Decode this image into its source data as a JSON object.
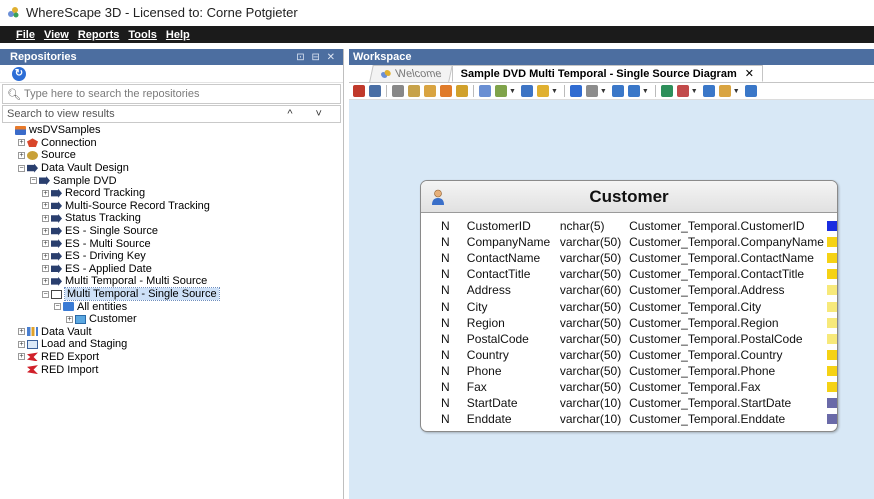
{
  "window": {
    "title": "WhereScape 3D - Licensed to: Corne Potgieter"
  },
  "menu": [
    "File",
    "View",
    "Reports",
    "Tools",
    "Help"
  ],
  "repositories": {
    "header": "Repositories",
    "header_controls": "⊡ ⊟ ✕",
    "search_placeholder": "Type here to search the repositories",
    "results_text": "Search to view results",
    "results_nav": "^ ˅"
  },
  "tree": [
    {
      "label": "wsDVSamples",
      "depth": 0,
      "icon": "database-icon",
      "iconClass": "ico-db",
      "expander": ""
    },
    {
      "label": "Connection",
      "depth": 1,
      "icon": "connection-icon",
      "iconClass": "ico-conn",
      "expander": "+"
    },
    {
      "label": "Source",
      "depth": 1,
      "icon": "source-icon",
      "iconClass": "ico-src",
      "expander": "+"
    },
    {
      "label": "Data Vault Design",
      "depth": 1,
      "icon": "model-icon",
      "iconClass": "ico-dv",
      "expander": "−"
    },
    {
      "label": "Sample DVD",
      "depth": 2,
      "icon": "model-icon",
      "iconClass": "ico-dv",
      "expander": "−"
    },
    {
      "label": "Record Tracking",
      "depth": 3,
      "icon": "model-icon",
      "iconClass": "ico-dv",
      "expander": "+"
    },
    {
      "label": "Multi-Source Record Tracking",
      "depth": 3,
      "icon": "model-icon",
      "iconClass": "ico-dv",
      "expander": "+"
    },
    {
      "label": "Status Tracking",
      "depth": 3,
      "icon": "model-icon",
      "iconClass": "ico-dv",
      "expander": "+"
    },
    {
      "label": "ES - Single Source",
      "depth": 3,
      "icon": "model-icon",
      "iconClass": "ico-dv",
      "expander": "+"
    },
    {
      "label": "ES - Multi Source",
      "depth": 3,
      "icon": "model-icon",
      "iconClass": "ico-dv",
      "expander": "+"
    },
    {
      "label": "ES - Driving Key",
      "depth": 3,
      "icon": "model-icon",
      "iconClass": "ico-dv",
      "expander": "+"
    },
    {
      "label": "ES - Applied Date",
      "depth": 3,
      "icon": "model-icon",
      "iconClass": "ico-dv",
      "expander": "+"
    },
    {
      "label": "Multi Temporal - Multi Source",
      "depth": 3,
      "icon": "model-icon",
      "iconClass": "ico-dv",
      "expander": "+"
    },
    {
      "label": "Multi Temporal - Single Source",
      "depth": 3,
      "icon": "document-icon",
      "iconClass": "ico-doc",
      "expander": "−",
      "selected": true
    },
    {
      "label": "All entities",
      "depth": 4,
      "icon": "entities-icon",
      "iconClass": "ico-entities",
      "expander": "−"
    },
    {
      "label": "Customer",
      "depth": 5,
      "icon": "entity-icon",
      "iconClass": "ico-cust",
      "expander": "+"
    },
    {
      "label": "Data Vault",
      "depth": 1,
      "icon": "data-vault-icon",
      "iconClass": "ico-vault",
      "expander": "+"
    },
    {
      "label": "Load and Staging",
      "depth": 1,
      "icon": "load-icon",
      "iconClass": "ico-load",
      "expander": "+"
    },
    {
      "label": "RED Export",
      "depth": 1,
      "icon": "red-export-icon",
      "iconClass": "ico-red",
      "expander": "+"
    },
    {
      "label": "RED Import",
      "depth": 1,
      "icon": "red-import-icon",
      "iconClass": "ico-red",
      "expander": ""
    }
  ],
  "workspace": {
    "header": "Workspace",
    "tabs": [
      {
        "label": "Welcome",
        "active": false
      },
      {
        "label": "Sample DVD Multi Temporal - Single Source Diagram",
        "active": true,
        "close": "✕"
      }
    ]
  },
  "toolbar_colors": [
    "#c0392b",
    "#4a6fa5",
    "#888888",
    "#c7a24a",
    "#d9a441",
    "#e07b2a",
    "#d1a12b",
    "#6a8fd3",
    "#7fa34a",
    "#3d74c4",
    "#e0b030",
    "#2f6bd1",
    "#8c8c8c",
    "#3a77c8",
    "#3a77c8",
    "#2d8f5a",
    "#c24a4a",
    "#3a77c8",
    "#d9a441",
    "#3a77c8"
  ],
  "entity": {
    "title": "Customer",
    "attributes": [
      {
        "flag": "N",
        "name": "CustomerID",
        "type": "nchar(5)",
        "source": "Customer_Temporal.CustomerID",
        "color": "#1a2de0"
      },
      {
        "flag": "N",
        "name": "CompanyName",
        "type": "varchar(50)",
        "source": "Customer_Temporal.CompanyName",
        "color": "#f5d214"
      },
      {
        "flag": "N",
        "name": "ContactName",
        "type": "varchar(50)",
        "source": "Customer_Temporal.ContactName",
        "color": "#f5d214"
      },
      {
        "flag": "N",
        "name": "ContactTitle",
        "type": "varchar(50)",
        "source": "Customer_Temporal.ContactTitle",
        "color": "#f5d214"
      },
      {
        "flag": "N",
        "name": "Address",
        "type": "varchar(60)",
        "source": "Customer_Temporal.Address",
        "color": "#f7e97a"
      },
      {
        "flag": "N",
        "name": "City",
        "type": "varchar(50)",
        "source": "Customer_Temporal.City",
        "color": "#f7e97a"
      },
      {
        "flag": "N",
        "name": "Region",
        "type": "varchar(50)",
        "source": "Customer_Temporal.Region",
        "color": "#f7e97a"
      },
      {
        "flag": "N",
        "name": "PostalCode",
        "type": "varchar(50)",
        "source": "Customer_Temporal.PostalCode",
        "color": "#f7e97a"
      },
      {
        "flag": "N",
        "name": "Country",
        "type": "varchar(50)",
        "source": "Customer_Temporal.Country",
        "color": "#f5d214"
      },
      {
        "flag": "N",
        "name": "Phone",
        "type": "varchar(50)",
        "source": "Customer_Temporal.Phone",
        "color": "#f5d214"
      },
      {
        "flag": "N",
        "name": "Fax",
        "type": "varchar(50)",
        "source": "Customer_Temporal.Fax",
        "color": "#f5d214"
      },
      {
        "flag": "N",
        "name": "StartDate",
        "type": "varchar(10)",
        "source": "Customer_Temporal.StartDate",
        "color": "#6a6aa8"
      },
      {
        "flag": "N",
        "name": "Enddate",
        "type": "varchar(10)",
        "source": "Customer_Temporal.Enddate",
        "color": "#6a6aa8"
      }
    ]
  }
}
